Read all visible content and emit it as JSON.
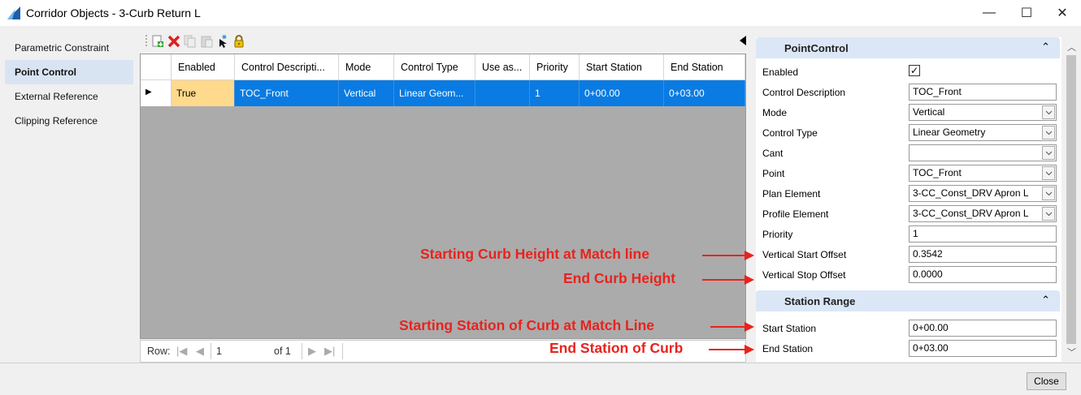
{
  "window": {
    "title": "Corridor Objects - 3-Curb Return L",
    "minimize": "—",
    "maximize": "☐",
    "close": "✕"
  },
  "nav": {
    "items": [
      {
        "label": "Parametric Constraint",
        "active": false
      },
      {
        "label": "Point Control",
        "active": true
      },
      {
        "label": "External Reference",
        "active": false
      },
      {
        "label": "Clipping Reference",
        "active": false
      }
    ]
  },
  "toolbar": {
    "icons": [
      "new-icon",
      "delete-icon",
      "copy-icon",
      "paste-icon",
      "select-icon",
      "lock-icon"
    ]
  },
  "grid": {
    "headers": [
      "Enabled",
      "Control Descripti...",
      "Mode",
      "Control Type",
      "Use as...",
      "Priority",
      "Start Station",
      "End Station"
    ],
    "rows": [
      {
        "indicator": "▶",
        "cells": [
          "True",
          "TOC_Front",
          "Vertical",
          "Linear Geom...",
          "",
          "1",
          "0+00.00",
          "0+03.00"
        ]
      }
    ],
    "pager": {
      "row_label": "Row:",
      "row_value": "1",
      "of_label": "of 1"
    }
  },
  "props": {
    "point_control_title": "PointControl",
    "point_control": [
      {
        "label": "Enabled",
        "type": "checkbox",
        "value": "✓"
      },
      {
        "label": "Control Description",
        "type": "text",
        "value": "TOC_Front"
      },
      {
        "label": "Mode",
        "type": "select",
        "value": "Vertical"
      },
      {
        "label": "Control Type",
        "type": "select",
        "value": "Linear Geometry"
      },
      {
        "label": "Cant",
        "type": "select",
        "value": ""
      },
      {
        "label": "Point",
        "type": "select",
        "value": "TOC_Front"
      },
      {
        "label": "Plan Element",
        "type": "select",
        "value": "3-CC_Const_DRV Apron L"
      },
      {
        "label": "Profile Element",
        "type": "select",
        "value": "3-CC_Const_DRV Apron L"
      },
      {
        "label": "Priority",
        "type": "text",
        "value": "1"
      },
      {
        "label": "Vertical Start Offset",
        "type": "text",
        "value": "0.3542"
      },
      {
        "label": "Vertical Stop Offset",
        "type": "text",
        "value": "0.0000"
      }
    ],
    "station_range_title": "Station Range",
    "station_range": [
      {
        "label": "Start Station",
        "type": "text",
        "value": "0+00.00"
      },
      {
        "label": "End Station",
        "type": "text",
        "value": "0+03.00"
      }
    ]
  },
  "annotations": [
    "Starting Curb Height at Match line",
    "End Curb Height",
    "Starting Station of Curb at Match Line",
    "End Station of Curb"
  ],
  "footer": {
    "close_label": "Close"
  },
  "colors": {
    "selection": "#0a7be2",
    "current_cell": "#ffd98c",
    "annotation": "#e8231e",
    "section_header": "#dbe7f7"
  }
}
